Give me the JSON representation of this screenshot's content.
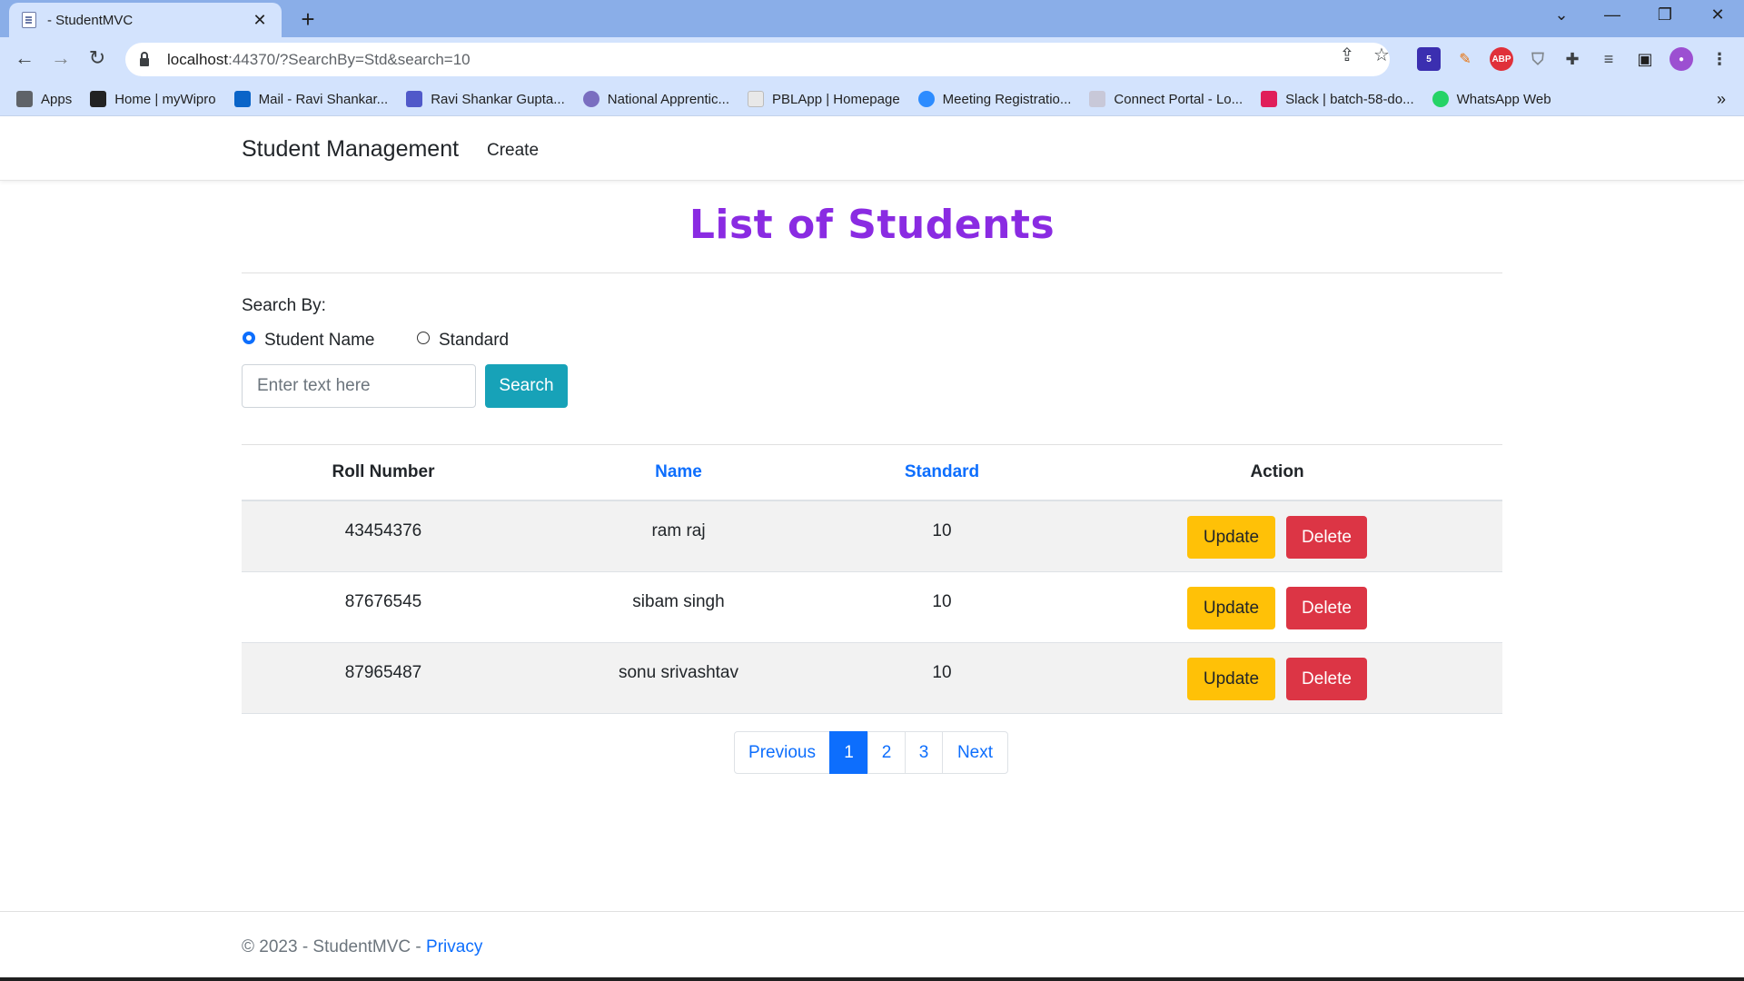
{
  "browser": {
    "tab_title": "- StudentMVC",
    "url_host": "localhost",
    "url_rest": ":44370/?SearchBy=Std&search=10",
    "bookmarks": [
      {
        "label": "Apps",
        "color": "#3c4043"
      },
      {
        "label": "Home | myWipro",
        "color": "#222222"
      },
      {
        "label": "Mail - Ravi Shankar...",
        "color": "#0a64c8"
      },
      {
        "label": "Ravi Shankar Gupta...",
        "color": "#5059c9"
      },
      {
        "label": "National Apprentic...",
        "color": "#7a6ec0"
      },
      {
        "label": "PBLApp | Homepage",
        "color": "#e8e8e8"
      },
      {
        "label": "Meeting Registratio...",
        "color": "#2d8cff"
      },
      {
        "label": "Connect Portal - Lo...",
        "color": "#c8c8d8"
      },
      {
        "label": "Slack | batch-58-do...",
        "color": "#e01e5a"
      },
      {
        "label": "WhatsApp Web",
        "color": "#25d366"
      }
    ]
  },
  "app": {
    "brand": "Student Management",
    "nav_create": "Create"
  },
  "main": {
    "heading": "List of Students",
    "search_by_label": "Search By:",
    "radio_name_label": "Student Name",
    "radio_standard_label": "Standard",
    "search_placeholder": "Enter text here",
    "search_button": "Search"
  },
  "table": {
    "columns": [
      "Roll Number",
      "Name",
      "Standard",
      "Action"
    ],
    "rows": [
      {
        "roll": "43454376",
        "name": "ram raj",
        "standard": "10",
        "update": "Update",
        "delete": "Delete"
      },
      {
        "roll": "87676545",
        "name": "sibam singh",
        "standard": "10",
        "update": "Update",
        "delete": "Delete"
      },
      {
        "roll": "87965487",
        "name": "sonu srivashtav",
        "standard": "10",
        "update": "Update",
        "delete": "Delete"
      }
    ]
  },
  "pagination": {
    "previous": "Previous",
    "pages": [
      "1",
      "2",
      "3"
    ],
    "next": "Next",
    "active_page": "1"
  },
  "footer": {
    "text": "© 2023 - StudentMVC - ",
    "privacy": "Privacy"
  },
  "colors": {
    "heading": "#8a2be2",
    "primary": "#0d6efd",
    "search_button": "#17a2b8",
    "update_button": "#ffc107",
    "delete_button": "#dc3545"
  }
}
